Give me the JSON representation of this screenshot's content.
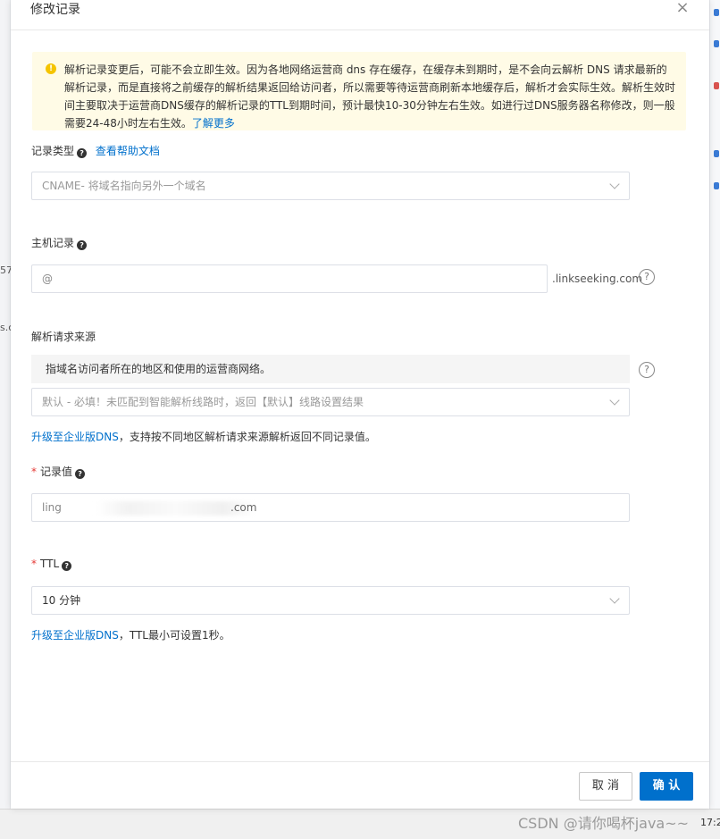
{
  "background": {
    "left_fragments": [
      "57",
      "s.c"
    ],
    "watermark": "CSDN @请你喝杯java~~",
    "clock": "17:2"
  },
  "dialog": {
    "title": "修改记录",
    "close_label": "×"
  },
  "notice": {
    "icon": "!",
    "text": "解析记录变更后，可能不会立即生效。因为各地网络运营商 dns 存在缓存，在缓存未到期时，是不会向云解析 DNS 请求最新的解析记录，而是直接将之前缓存的解析结果返回给访问者，所以需要等待运营商刷新本地缓存后，解析才会实际生效。解析生效时间主要取决于运营商DNS缓存的解析记录的TTL到期时间，预计最快10-30分钟左右生效。如进行过DNS服务器名称修改，则一般需要24-48小时左右生效。",
    "link": "了解更多"
  },
  "form": {
    "record_type": {
      "label": "记录类型",
      "help_link": "查看帮助文档",
      "value": "CNAME- 将域名指向另外一个域名"
    },
    "host": {
      "label": "主机记录",
      "value": "@",
      "suffix": ".linkseeking.com"
    },
    "source": {
      "label": "解析请求来源",
      "hint": "指域名访问者所在的地区和使用的运营商网络。",
      "value": "默认 - 必填！未匹配到智能解析线路时，返回【默认】线路设置结果",
      "upgrade_link": "升级至企业版DNS",
      "upgrade_text": "，支持按不同地区解析请求来源解析返回不同记录值。"
    },
    "record_value": {
      "required": "*",
      "label": "记录值",
      "value_prefix": "ling",
      "value_suffix": ".com"
    },
    "ttl": {
      "required": "*",
      "label": "TTL",
      "value": "10 分钟",
      "upgrade_link": "升级至企业版DNS",
      "upgrade_text": "，TTL最小可设置1秒。"
    },
    "help_glyph": "?",
    "question_glyph": "?"
  },
  "footer": {
    "cancel_label": "取 消",
    "ok_label": "确 认"
  },
  "colors": {
    "accent": "#0070cc",
    "notice_bg": "#fffbe6",
    "warning_icon": "#f5c400",
    "required": "#e53935"
  }
}
